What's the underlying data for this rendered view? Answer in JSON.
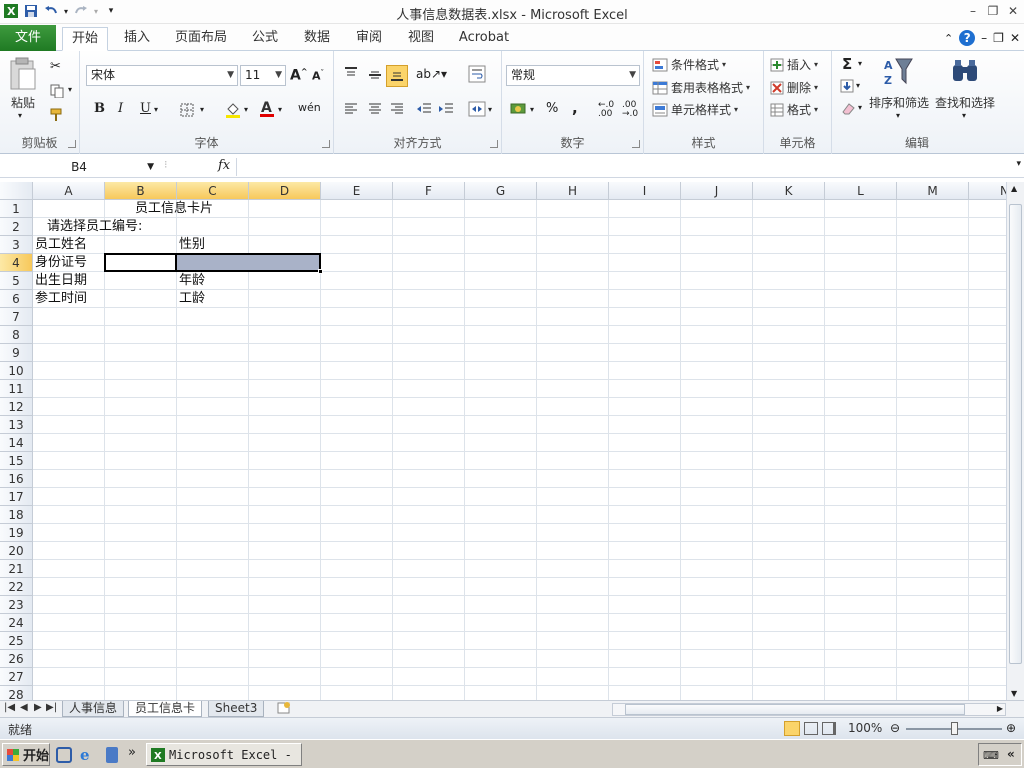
{
  "window": {
    "title": "人事信息数据表.xlsx - Microsoft Excel"
  },
  "ribbon": {
    "file_tab": "文件",
    "tabs": [
      "开始",
      "插入",
      "页面布局",
      "公式",
      "数据",
      "审阅",
      "视图",
      "Acrobat"
    ],
    "active_tab": "开始",
    "clipboard": {
      "paste": "粘贴",
      "label": "剪贴板"
    },
    "font": {
      "name": "宋体",
      "size": "11",
      "label": "字体",
      "bold": "B",
      "italic": "I",
      "underline": "U"
    },
    "alignment": {
      "label": "对齐方式"
    },
    "number": {
      "format": "常规",
      "label": "数字",
      "percent": "%",
      "comma": ","
    },
    "styles": {
      "conditional": "条件格式",
      "table": "套用表格格式",
      "cell": "单元格样式",
      "label": "样式"
    },
    "cells": {
      "insert": "插入",
      "delete": "删除",
      "format": "格式",
      "label": "单元格"
    },
    "editing": {
      "sort": "排序和筛选",
      "find": "查找和选择",
      "label": "编辑",
      "sigma": "Σ"
    }
  },
  "formula_bar": {
    "name_box": "B4",
    "fx": "fx",
    "value": ""
  },
  "grid": {
    "columns": [
      "A",
      "B",
      "C",
      "D",
      "E",
      "F",
      "G",
      "H",
      "I",
      "J",
      "K",
      "L",
      "M",
      "N"
    ],
    "selected_columns": [
      "B",
      "C",
      "D"
    ],
    "rows": [
      "1",
      "2",
      "3",
      "4",
      "5",
      "6",
      "7",
      "8",
      "9",
      "10",
      "11",
      "12",
      "13",
      "14",
      "15",
      "16",
      "17",
      "18",
      "19",
      "20",
      "21",
      "22",
      "23",
      "24",
      "25",
      "26",
      "27",
      "28"
    ],
    "selected_row": "4",
    "cells": {
      "B1": "员工信息卡片",
      "A2": "请选择员工编号:",
      "A3": "员工姓名",
      "C3": "性别",
      "A4": "身份证号",
      "A5": "出生日期",
      "C5": "年龄",
      "A6": "参工时间",
      "C6": "工龄"
    },
    "active_cell": "B4",
    "selection_fill": "#a9b2c8"
  },
  "sheets": {
    "tabs": [
      "人事信息",
      "员工信息卡",
      "Sheet3"
    ],
    "active": "员工信息卡"
  },
  "status": {
    "text": "就绪",
    "zoom": "100%"
  },
  "taskbar": {
    "start": "开始",
    "app_button": "Microsoft Excel - ...",
    "chevron": "»"
  },
  "colors": {
    "file_tab": "#2a8a2e",
    "header_selected": "#f7c85b",
    "accent_blue": "#1e6fd0"
  }
}
